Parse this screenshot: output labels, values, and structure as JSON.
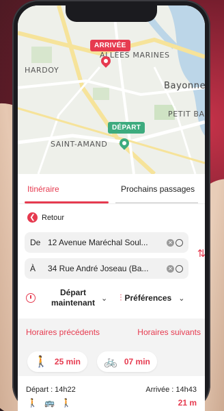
{
  "map": {
    "arrivee_tag": "ARRIVÉE",
    "depart_tag": "DÉPART",
    "labels": {
      "hardoy": "HARDOY",
      "allees_marines": "ALLÉES MARINES",
      "bayonne": "Bayonne",
      "petit_ba": "PETIT BA",
      "saint_amand": "SAINT-AMAND"
    }
  },
  "tabs": {
    "itineraire": "Itinéraire",
    "prochains": "Prochains passages"
  },
  "retour": "Retour",
  "route": {
    "from_prefix": "De",
    "from_address": "12 Avenue Maréchal Soul...",
    "to_prefix": "À",
    "to_address": "34 Rue André Joseau (Ba..."
  },
  "options": {
    "depart_line1": "Départ",
    "depart_line2": "maintenant",
    "preferences": "Préférences"
  },
  "horaires": {
    "previous": "Horaires précédents",
    "next": "Horaires suivants"
  },
  "modes": {
    "walk_time": "25 min",
    "bike_time": "07 min"
  },
  "result": {
    "depart": "Départ : 14h22",
    "arrivee": "Arrivée : 14h43",
    "duration_partial": "21 m"
  },
  "colors": {
    "accent": "#e63a4f",
    "green": "#3dab7e"
  }
}
